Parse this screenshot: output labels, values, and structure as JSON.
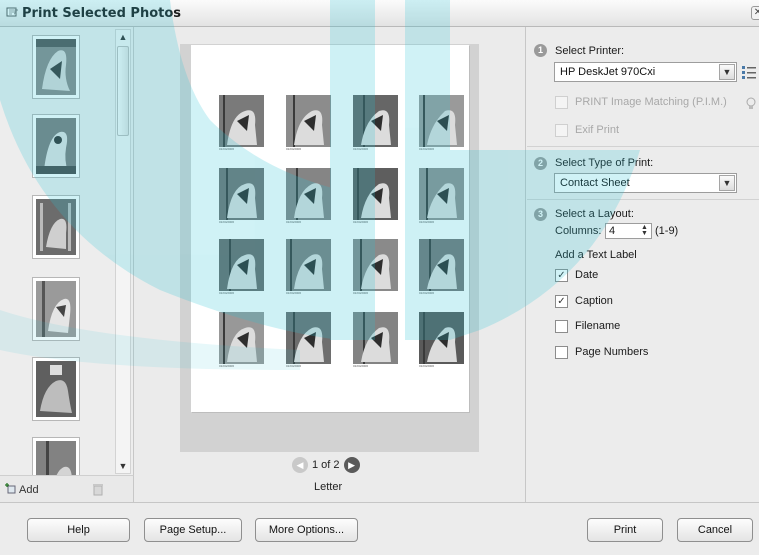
{
  "window": {
    "title": "Print Selected Photos"
  },
  "thumbnails": {
    "add_label": "Add"
  },
  "preview": {
    "page_indicator": "1 of 2",
    "paper_size": "Letter",
    "caption_text": "01/04/2006"
  },
  "options": {
    "printer": {
      "step": "1",
      "title": "Select Printer:",
      "selected": "HP DeskJet 970Cxi"
    },
    "pim_label": "PRINT Image Matching (P.I.M.)",
    "exif_label": "Exif Print",
    "print_type": {
      "step": "2",
      "title": "Select Type of Print:",
      "selected": "Contact Sheet"
    },
    "layout": {
      "step": "3",
      "title": "Select a Layout:",
      "columns_label": "Columns:",
      "columns_value": "4",
      "columns_range": "(1-9)",
      "text_label_heading": "Add a Text Label",
      "labels": [
        {
          "text": "Date",
          "checked": true
        },
        {
          "text": "Caption",
          "checked": true
        },
        {
          "text": "Filename",
          "checked": false
        },
        {
          "text": "Page Numbers",
          "checked": false
        }
      ]
    }
  },
  "buttons": {
    "help": "Help",
    "page_setup": "Page Setup...",
    "more_options": "More Options...",
    "print": "Print",
    "cancel": "Cancel"
  },
  "colors": {
    "watermark": "#27c3d6",
    "accent_step": "#9a9a9a"
  }
}
